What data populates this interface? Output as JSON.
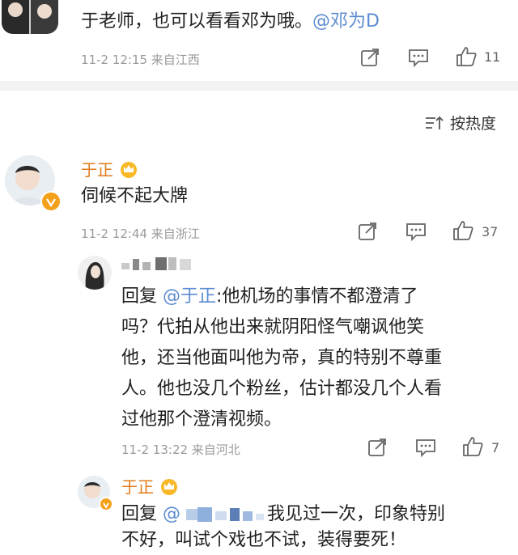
{
  "comments": [
    {
      "text": "于老师，也可以看看邓为哦。",
      "mention": "@邓为D",
      "meta": "11-2 12:15 来自江西",
      "likes": "11"
    },
    {
      "name": "于正",
      "text": "伺候不起大牌",
      "meta": "11-2 12:44 来自浙江",
      "likes": "37",
      "replies": [
        {
          "reply_prefix": "回复",
          "mention": "@于正",
          "text_lines": [
            ":他机场的事情不都澄清了",
            "吗？代拍从他出来就阴阳怪气嘲讽他笑",
            "他，还当他面叫他为帝，真的特别不尊重",
            "人。他也没几个粉丝，估计都没几个人看",
            "过他那个澄清视频。"
          ],
          "meta": "11-2 13:22 来自河北",
          "likes": "7"
        },
        {
          "name": "于正",
          "reply_prefix": "回复",
          "mention": "@",
          "text_line1": "我见过一次，印象特别",
          "text_line2": "不好，叫试个戏也不试，装得要死！"
        }
      ]
    }
  ],
  "sort_label": "按热度",
  "icons": [
    "share-icon",
    "comment-icon",
    "like-icon",
    "crown-icon",
    "verified-badge-icon",
    "sort-icon"
  ]
}
